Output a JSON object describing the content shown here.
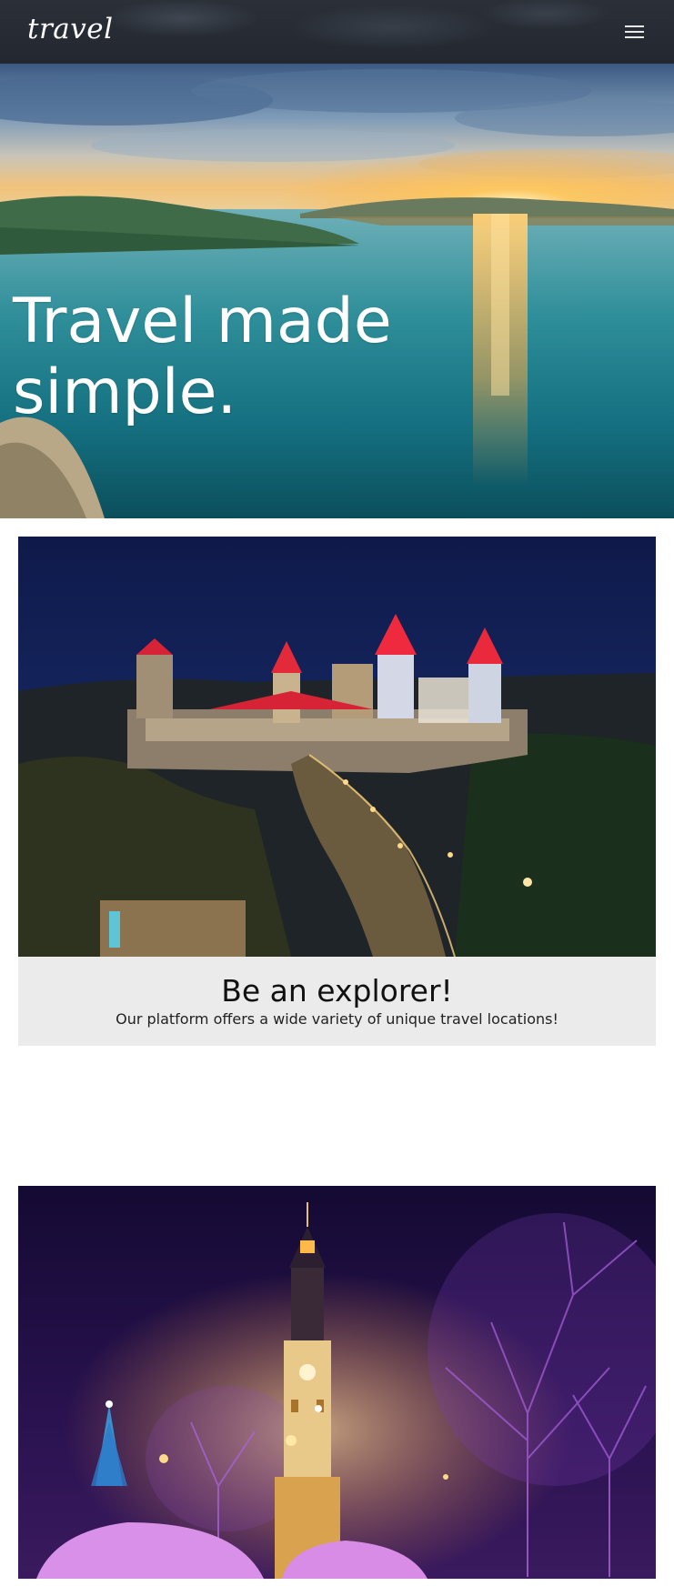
{
  "navbar": {
    "logo": "travel",
    "menu_icon": "hamburger-menu-icon"
  },
  "hero": {
    "title": "Travel made simple.",
    "image": "sunset-lake-landscape"
  },
  "feature_card": {
    "image": "illuminated-castle-at-night",
    "title": "Be an explorer!",
    "text": "Our platform offers a wide variety of unique travel locations!"
  },
  "second_photo": {
    "image": "town-hall-tower-at-night-purple-lights"
  },
  "colors": {
    "navbar_bg": "#262b33",
    "card_body_bg": "#ebebeb",
    "text_dark": "#111111",
    "text_light": "#ffffff"
  }
}
